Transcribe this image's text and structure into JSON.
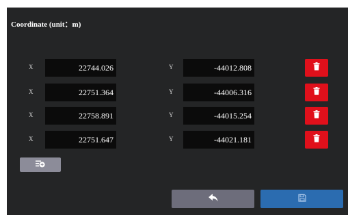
{
  "panel": {
    "title": "Coordinate (unit：m)"
  },
  "rows": [
    {
      "x_label": "X",
      "x_value": "22744.026",
      "y_label": "Y",
      "y_value": "-44012.808"
    },
    {
      "x_label": "X",
      "x_value": "22751.364",
      "y_label": "Y",
      "y_value": "-44006.316"
    },
    {
      "x_label": "X",
      "x_value": "22758.891",
      "y_label": "Y",
      "y_value": "-44015.254"
    },
    {
      "x_label": "X",
      "x_value": "22751.647",
      "y_label": "Y",
      "y_value": "-44021.181"
    }
  ],
  "icons": {
    "delete": "trash-icon",
    "add": "add-list-icon",
    "back": "reply-arrow-icon",
    "save": "floppy-disk-icon"
  },
  "colors": {
    "panel_bg": "#242526",
    "field_bg": "#0b0b0b",
    "delete_btn": "#e0101b",
    "add_btn": "#8c8c99",
    "back_btn": "#6d6d7b",
    "save_btn": "#2b6cb0"
  }
}
